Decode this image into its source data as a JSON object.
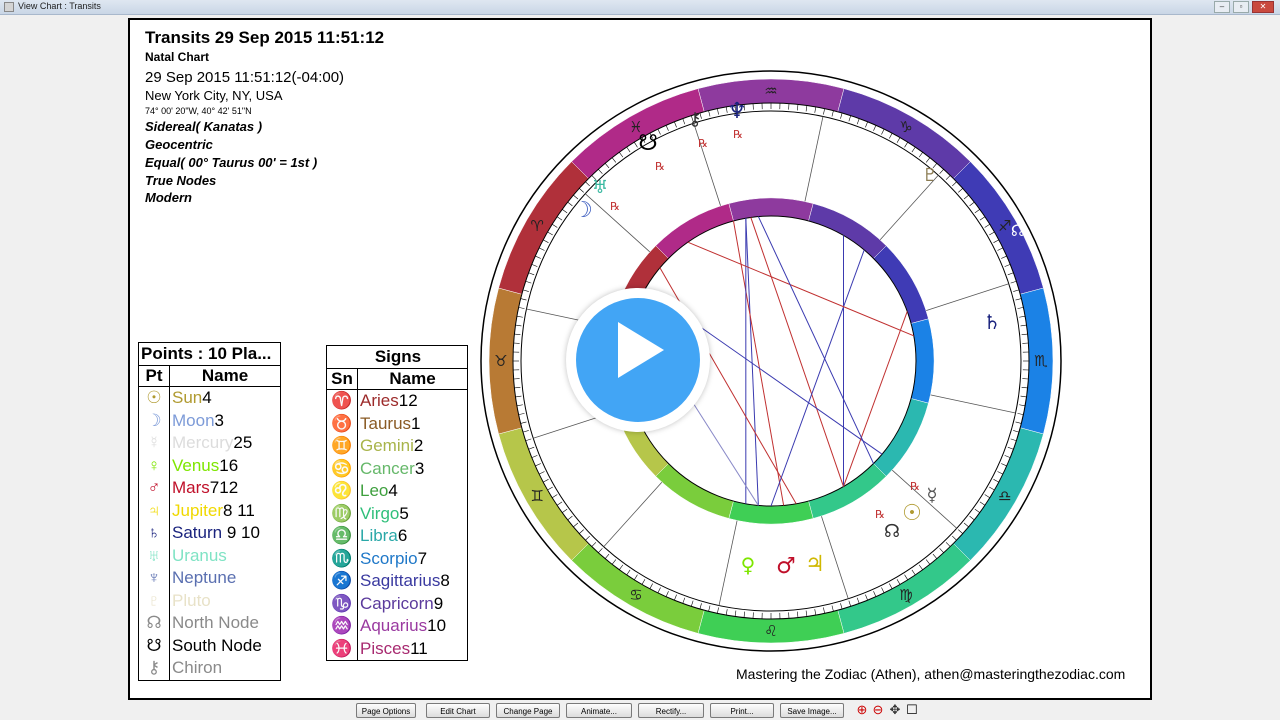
{
  "window": {
    "title": "View Chart : Transits"
  },
  "header": {
    "title": "Transits 29 Sep 2015 11:51:12",
    "subtitle": "Natal Chart",
    "datetime": "29 Sep 2015 11:51:12(-04:00)",
    "place": "New York City, NY, USA",
    "coords": "74° 00' 20\"W, 40° 42' 51\"N",
    "settings": [
      "Sidereal( Kanatas )",
      "Geocentric",
      "Equal( 00° Taurus 00' = 1st )",
      "True Nodes",
      "Modern"
    ]
  },
  "points_table": {
    "caption": "Points : 10 Pla...",
    "col_pt": "Pt",
    "col_name": "Name",
    "rows": [
      {
        "glyph": "☉",
        "name": "Sun",
        "num": "4",
        "color": "#b09a30"
      },
      {
        "glyph": "☽",
        "name": "Moon",
        "num": "3",
        "color": "#7d9bd8"
      },
      {
        "glyph": "☿",
        "name": "Mercury",
        "num": "25",
        "color": "#dcdcdc"
      },
      {
        "glyph": "♀",
        "name": "Venus",
        "num": "16",
        "color": "#7ee600"
      },
      {
        "glyph": "♂",
        "name": "Mars",
        "num": "712",
        "color": "#c0102a"
      },
      {
        "glyph": "♃",
        "name": "Jupiter",
        "num": "8 11",
        "color": "#f0d800"
      },
      {
        "glyph": "♄",
        "name": "Saturn",
        "num": " 9 10",
        "color": "#1a237e"
      },
      {
        "glyph": "♅",
        "name": "Uranus",
        "num": "",
        "color": "#7fe3c4"
      },
      {
        "glyph": "♆",
        "name": "Neptune",
        "num": "",
        "color": "#5a6fb0"
      },
      {
        "glyph": "♇",
        "name": "Pluto",
        "num": "",
        "color": "#e8e2c8"
      },
      {
        "glyph": "☊",
        "name": "North Node",
        "num": "",
        "color": "#8a8a8a"
      },
      {
        "glyph": "☋",
        "name": "South Node",
        "num": "",
        "color": "#000000"
      },
      {
        "glyph": "⚷",
        "name": "Chiron",
        "num": "",
        "color": "#8a8a8a"
      }
    ]
  },
  "signs_table": {
    "caption": "Signs",
    "col_sn": "Sn",
    "col_name": "Name",
    "rows": [
      {
        "glyph": "♈",
        "name": "Aries",
        "num": "12",
        "color": "#9c2a2a"
      },
      {
        "glyph": "♉",
        "name": "Taurus",
        "num": "1",
        "color": "#8a5a24"
      },
      {
        "glyph": "♊",
        "name": "Gemini",
        "num": "2",
        "color": "#a8b44a"
      },
      {
        "glyph": "♋",
        "name": "Cancer",
        "num": "3",
        "color": "#66b86a"
      },
      {
        "glyph": "♌",
        "name": "Leo",
        "num": "4",
        "color": "#3fa03f"
      },
      {
        "glyph": "♍",
        "name": "Virgo",
        "num": "5",
        "color": "#2fbf7a"
      },
      {
        "glyph": "♎",
        "name": "Libra",
        "num": "6",
        "color": "#2aa8a8"
      },
      {
        "glyph": "♏",
        "name": "Scorpio",
        "num": "7",
        "color": "#1f78c8"
      },
      {
        "glyph": "♐",
        "name": "Sagittarius",
        "num": "8",
        "color": "#3a3aa0"
      },
      {
        "glyph": "♑",
        "name": "Capricorn",
        "num": "9",
        "color": "#5b3a9c"
      },
      {
        "glyph": "♒",
        "name": "Aquarius",
        "num": "10",
        "color": "#9a3aa0"
      },
      {
        "glyph": "♓",
        "name": "Pisces",
        "num": "11",
        "color": "#a82a70"
      }
    ]
  },
  "footer": {
    "credit": "Mastering the Zodiac (Athen), athen@masteringthezodiac.com"
  },
  "buttons": [
    "Page Options",
    "Edit Chart",
    "Change Page",
    "Animate...",
    "Rectify...",
    "Print...",
    "Save Image..."
  ],
  "zoom_icons": [
    "zoom-in-icon",
    "zoom-out-icon",
    "pan-icon",
    "fit-icon"
  ],
  "video": {
    "play_icon": "play-icon",
    "accent": "#42a5f5"
  },
  "wheel": {
    "outer_sign_band": [
      {
        "sign": "♒",
        "color": "#8e3a9e"
      },
      {
        "sign": "♑",
        "color": "#5e3aa8"
      },
      {
        "sign": "♐",
        "color": "#3f3bb5"
      },
      {
        "sign": "♏",
        "color": "#1b82e6"
      },
      {
        "sign": "♎",
        "color": "#2bb8b0"
      },
      {
        "sign": "♍",
        "color": "#33c88a"
      },
      {
        "sign": "♌",
        "color": "#3fcf55"
      },
      {
        "sign": "♋",
        "color": "#7acd3c"
      },
      {
        "sign": "♊",
        "color": "#b6c64a"
      },
      {
        "sign": "♉",
        "color": "#b87a34"
      },
      {
        "sign": "♈",
        "color": "#b0303a"
      },
      {
        "sign": "♓",
        "color": "#b02a88"
      }
    ],
    "transit_glyphs": [
      "♆",
      "⚷",
      "☋",
      "♅",
      "☽",
      "♇",
      "☊",
      "♄",
      "♀",
      "♂",
      "♃",
      "☉",
      "☿",
      "☊"
    ],
    "retro_mark": "℞"
  }
}
